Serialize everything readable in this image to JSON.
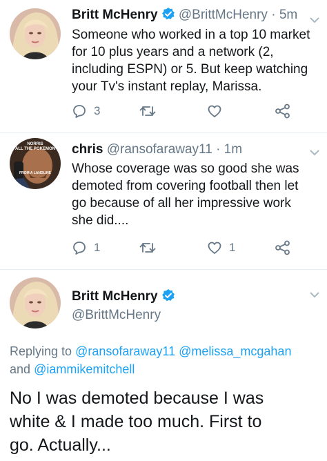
{
  "tweets": [
    {
      "author_name": "Britt McHenry",
      "handle": "@BrittMcHenry",
      "sep": "·",
      "time": "5m",
      "lines": [
        "Someone who worked in a top 10 market",
        "for 10 plus years and a network (2,",
        "including ESPN) or 5. But keep watching",
        "your Tv's instant replay, Marissa."
      ],
      "reply_count": "3",
      "retweet_count": "",
      "like_count": ""
    },
    {
      "author_name": "chris",
      "handle": "@ransofaraway11",
      "sep": "·",
      "time": "1m",
      "avatar_text_top": "NORRIS",
      "avatar_text_mid": "ALL THE POKEMON",
      "avatar_text_bottom": "FROM A LANDLINE",
      "lines": [
        "Whose coverage was so good she was",
        "demoted from covering football then let",
        "go because of all her impressive work",
        "she did...."
      ],
      "reply_count": "1",
      "retweet_count": "",
      "like_count": "1"
    }
  ],
  "focused": {
    "author_name": "Britt McHenry",
    "handle": "@BrittMcHenry",
    "replying_prefix": "Replying to",
    "replying_1": "@ransofaraway11",
    "replying_2": "@melissa_mcgahan",
    "replying_and": "and",
    "replying_3": "@iammikemitchell",
    "lines": [
      "No I was demoted because I was",
      "white & I made too much. First to",
      "go. Actually..."
    ]
  },
  "colors": {
    "link": "#1da1f2",
    "muted": "#657786",
    "verified": "#1da1f2"
  },
  "icons": [
    "verified-badge-icon",
    "chevron-down-icon",
    "reply-icon",
    "retweet-icon",
    "like-icon",
    "share-icon"
  ]
}
